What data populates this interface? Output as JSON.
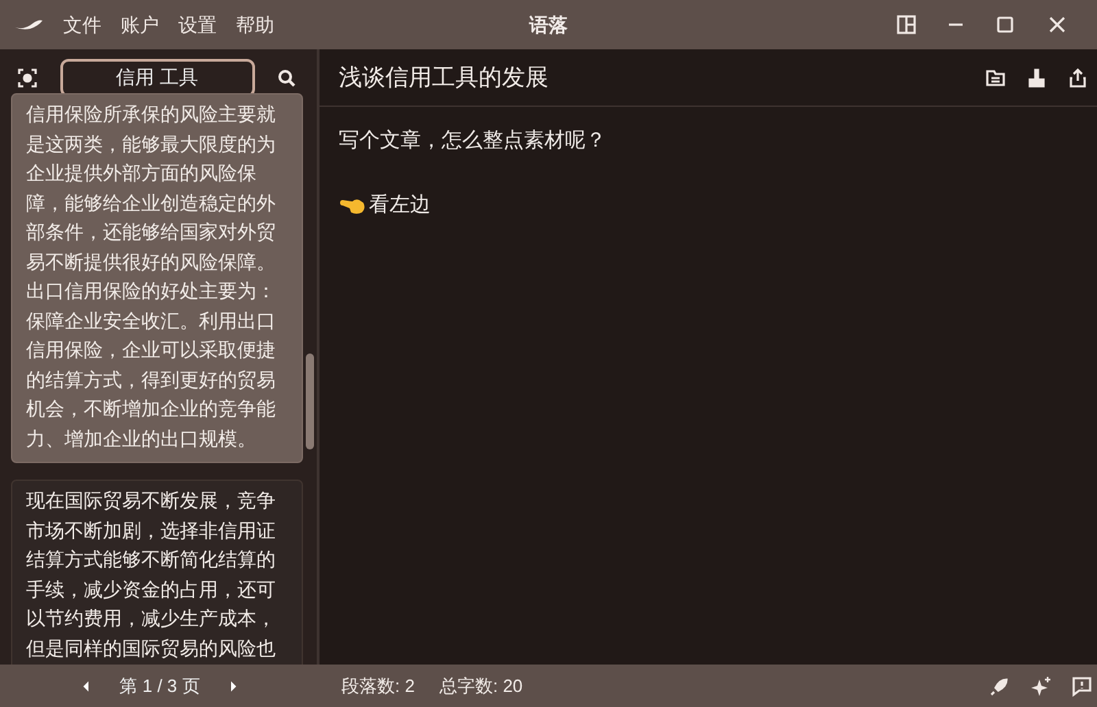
{
  "menu": [
    "文件",
    "账户",
    "设置",
    "帮助"
  ],
  "window": {
    "title": "语落"
  },
  "sidebar": {
    "search": {
      "value": "信用 工具"
    },
    "cards": [
      {
        "text": "信用保险所承保的风险主要就是这两类，能够最大限度的为企业提供外部方面的风险保障，能够给企业创造稳定的外部条件，还能够给国家对外贸易不断提供很好的风险保障。出口信用保险的好处主要为：保障企业安全收汇。利用出口信用保险，企业可以采取便捷的结算方式，得到更好的贸易机会，不断增加企业的竞争能力、增加企业的出口规模。",
        "selected": true
      },
      {
        "text": "现在国际贸易不断发展，竞争市场不断加剧，选择非信用证结算方式能够不断简化结算的手续，减少资金的占用，还可以节约费用，减少生产成本，但是同样的国际贸易的风险也",
        "selected": false
      }
    ],
    "pager": "第 1 / 3 页"
  },
  "document": {
    "title": "浅谈信用工具的发展",
    "paragraphs": [
      "写个文章，怎么整点素材呢？",
      "看左边"
    ]
  },
  "status_bar": {
    "paragraphs": "段落数: 2",
    "words": "总字数: 20"
  }
}
